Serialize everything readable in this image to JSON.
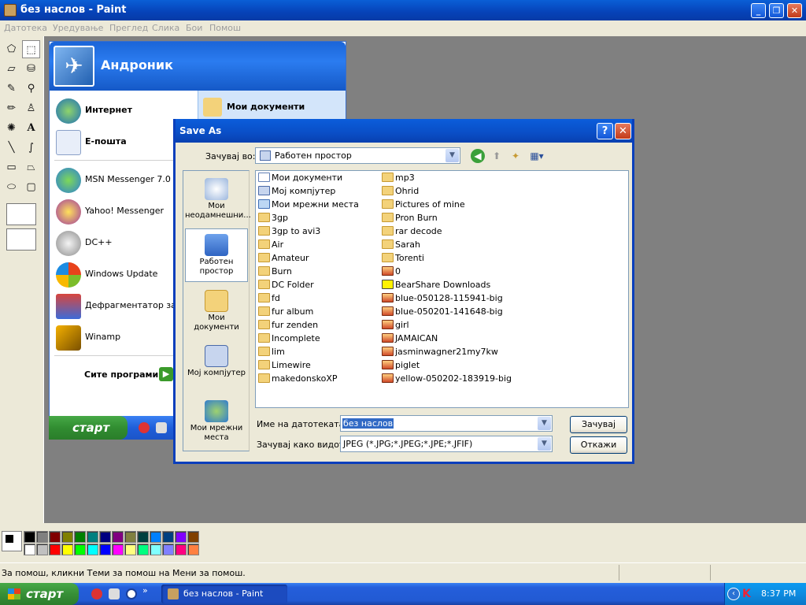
{
  "window": {
    "title": "без наслов - Paint",
    "minimize": "_",
    "maximize": "❐",
    "close": "✕"
  },
  "menu": [
    "Датотека",
    "Уредување",
    "Преглед",
    "Слика",
    "Бои",
    "Помош"
  ],
  "tools": [
    "free-select",
    "rect-select",
    "eraser",
    "fill",
    "color-picker",
    "magnifier",
    "pencil",
    "brush",
    "airbrush",
    "text",
    "line",
    "curve",
    "rectangle",
    "polygon",
    "ellipse",
    "rounded-rect"
  ],
  "start_menu": {
    "user": "Андроник",
    "pinned": [
      {
        "label": "Интернет",
        "icon": "ie-icon"
      },
      {
        "label": "Е-пошта",
        "icon": "mail-icon"
      }
    ],
    "recent": [
      {
        "label": "MSN Messenger 7.0",
        "icon": "msn-icon"
      },
      {
        "label": "Yahoo! Messenger",
        "icon": "yahoo-icon"
      },
      {
        "label": "DC++",
        "icon": "dcpp-icon"
      },
      {
        "label": "Windows Update",
        "icon": "windows-update-icon"
      },
      {
        "label": "Дефрагментатор за ди",
        "icon": "defrag-icon"
      },
      {
        "label": "Winamp",
        "icon": "winamp-icon"
      }
    ],
    "all_programs": "Сите програми",
    "right_item": "Мои документи",
    "start_label": "старт"
  },
  "dialog": {
    "title": "Save As",
    "help": "?",
    "close": "✕",
    "save_in_label": "Зачувај во:",
    "save_in_value": "Работен простор",
    "places": [
      {
        "label": "Мои неодамнешни...",
        "icon": "recent-docs-icon"
      },
      {
        "label": "Работен простор",
        "icon": "desktop-icon"
      },
      {
        "label": "Мои документи",
        "icon": "my-documents-icon"
      },
      {
        "label": "Мој компјутер",
        "icon": "my-computer-icon"
      },
      {
        "label": "Мои мрежни места",
        "icon": "network-places-icon"
      }
    ],
    "files_col1": [
      {
        "name": "Мои документи",
        "type": "doc"
      },
      {
        "name": "Мој компјутер",
        "type": "pc"
      },
      {
        "name": "Мои мрежни места",
        "type": "net"
      },
      {
        "name": "3gp",
        "type": "folder"
      },
      {
        "name": "3gp to avi3",
        "type": "folder"
      },
      {
        "name": "Air",
        "type": "folder"
      },
      {
        "name": "Amateur",
        "type": "folder"
      },
      {
        "name": "Burn",
        "type": "folder"
      },
      {
        "name": "DC Folder",
        "type": "folder"
      },
      {
        "name": "fd",
        "type": "folder"
      },
      {
        "name": "fur album",
        "type": "folder"
      },
      {
        "name": "fur zenden",
        "type": "folder"
      },
      {
        "name": "Incomplete",
        "type": "folder"
      },
      {
        "name": "lim",
        "type": "folder"
      },
      {
        "name": "Limewire",
        "type": "folder"
      },
      {
        "name": "makedonskoXP",
        "type": "folder"
      }
    ],
    "files_col2": [
      {
        "name": "mp3",
        "type": "folder"
      },
      {
        "name": "Ohrid",
        "type": "folder"
      },
      {
        "name": "Pictures of mine",
        "type": "folder"
      },
      {
        "name": "Pron Burn",
        "type": "folder"
      },
      {
        "name": "rar decode",
        "type": "folder"
      },
      {
        "name": "Sarah",
        "type": "folder"
      },
      {
        "name": "Torenti",
        "type": "folder"
      },
      {
        "name": "0",
        "type": "img"
      },
      {
        "name": "BearShare Downloads",
        "type": "bs"
      },
      {
        "name": "blue-050128-115941-big",
        "type": "img"
      },
      {
        "name": "blue-050201-141648-big",
        "type": "img"
      },
      {
        "name": "girl",
        "type": "img"
      },
      {
        "name": "JAMAICAN",
        "type": "img"
      },
      {
        "name": "jasminwagner21my7kw",
        "type": "img"
      },
      {
        "name": "piglet",
        "type": "img"
      },
      {
        "name": "yellow-050202-183919-big",
        "type": "img"
      }
    ],
    "filename_label": "Име на датотеката:",
    "filename_value": "без наслов",
    "filetype_label": "Зачувај како видот:",
    "filetype_value": "JPEG (*.JPG;*.JPEG;*.JPE;*.JFIF)",
    "save_button": "Зачувај",
    "cancel_button": "Откажи"
  },
  "palette": {
    "row1": [
      "#000000",
      "#808080",
      "#800000",
      "#808000",
      "#008000",
      "#008080",
      "#000080",
      "#800080",
      "#808040",
      "#004040",
      "#0080ff",
      "#004080",
      "#8000ff",
      "#804000"
    ],
    "row2": [
      "#ffffff",
      "#c0c0c0",
      "#ff0000",
      "#ffff00",
      "#00ff00",
      "#00ffff",
      "#0000ff",
      "#ff00ff",
      "#ffff80",
      "#00ff80",
      "#80ffff",
      "#8080ff",
      "#ff0080",
      "#ff8040"
    ]
  },
  "status": "За помош, кликни Теми за помош на Мени за помош.",
  "taskbar": {
    "start": "старт",
    "task": "без наслов - Paint",
    "clock": "8:37 PM",
    "chevron": "»"
  },
  "colors": {
    "xp_blue": "#0a5fd6",
    "start_green": "#318d31",
    "dialog_bg": "#ece9d8"
  }
}
